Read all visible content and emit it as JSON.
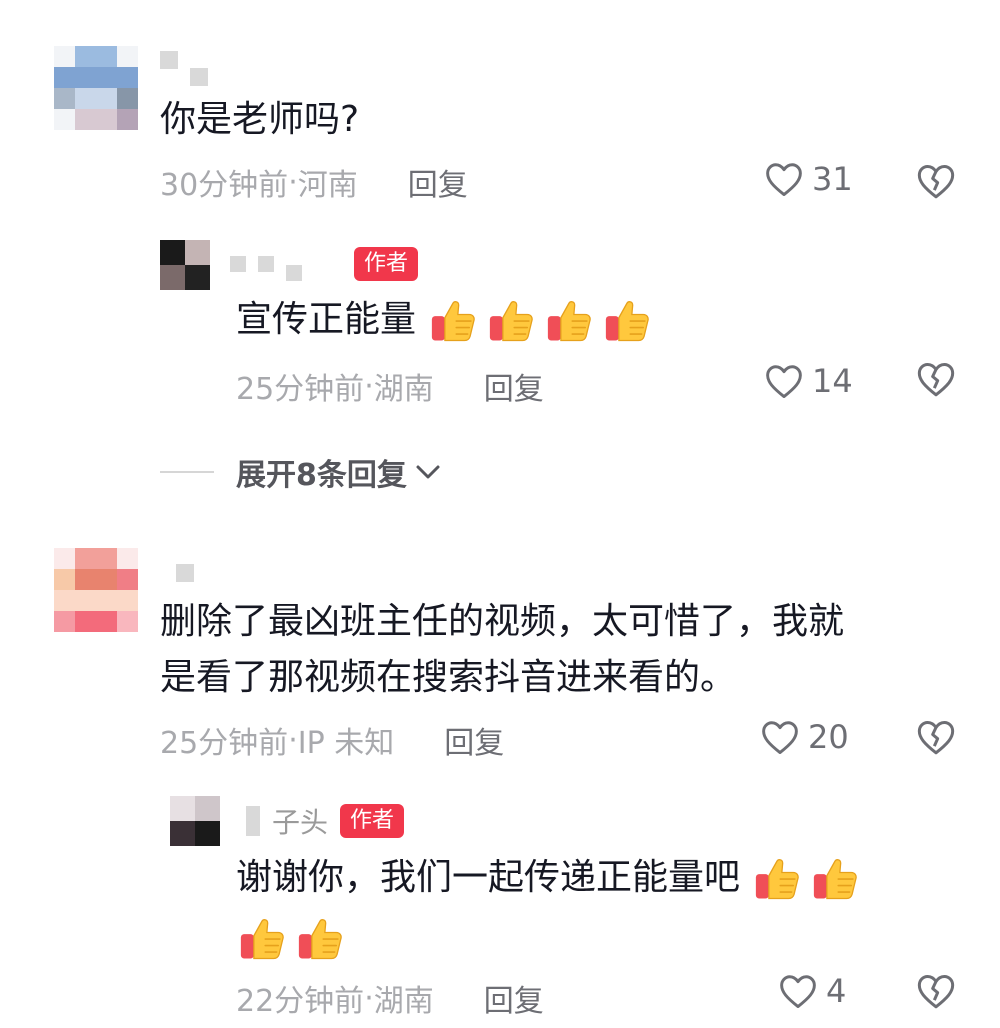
{
  "comments": [
    {
      "text": "你是老师吗?",
      "time": "30分钟前",
      "location": "河南",
      "reply_label": "回复",
      "likes": "31",
      "avatar_colors": [
        "#9bbbe0",
        "#7fa3d2",
        "#c9d7ea",
        "#a9b7c8",
        "#e6e9ee",
        "#8796a8",
        "#b4a3b6",
        "#d8c9d2"
      ],
      "replies": [
        {
          "name": "",
          "badge": "作者",
          "text": "宣传正能量",
          "emoji_count": 4,
          "time": "25分钟前",
          "location": "湖南",
          "reply_label": "回复",
          "likes": "14",
          "avatar_colors": [
            "#1a1a1a",
            "#7b6a6a",
            "#c4b4b4",
            "#222222"
          ]
        }
      ],
      "expand_label": "展开8条回复"
    },
    {
      "text_lines": [
        "删除了最凶班主任的视频，太可惜了，我就",
        "是看了那视频在搜索抖音进来看的。"
      ],
      "time": "25分钟前",
      "location": "IP 未知",
      "reply_label": "回复",
      "likes": "20",
      "avatar_colors": [
        "#f2a09a",
        "#e8836e",
        "#f7c9a8",
        "#f07e86",
        "#fbd9c8",
        "#f59aa3",
        "#f36b7b",
        "#f9b7be"
      ],
      "replies": [
        {
          "name": "子头",
          "badge": "作者",
          "text_line1": "谢谢你，我们一起传递正能量吧",
          "emoji_count_line1": 2,
          "emoji_count_line2": 2,
          "time": "22分钟前",
          "location": "湖南",
          "reply_label": "回复",
          "likes": "4",
          "avatar_colors": [
            "#e7e0e3",
            "#3a3036",
            "#1a1a1a",
            "#cfc6ca"
          ]
        }
      ]
    }
  ],
  "separator": "·",
  "icons": {
    "like": "heart-outline-icon",
    "dislike": "broken-heart-icon",
    "expand": "chevron-down-icon",
    "emoji": "thumbs-up-emoji"
  },
  "colors": {
    "badge": "#f1374b",
    "text": "#161823",
    "meta": "#a8a9ad"
  }
}
